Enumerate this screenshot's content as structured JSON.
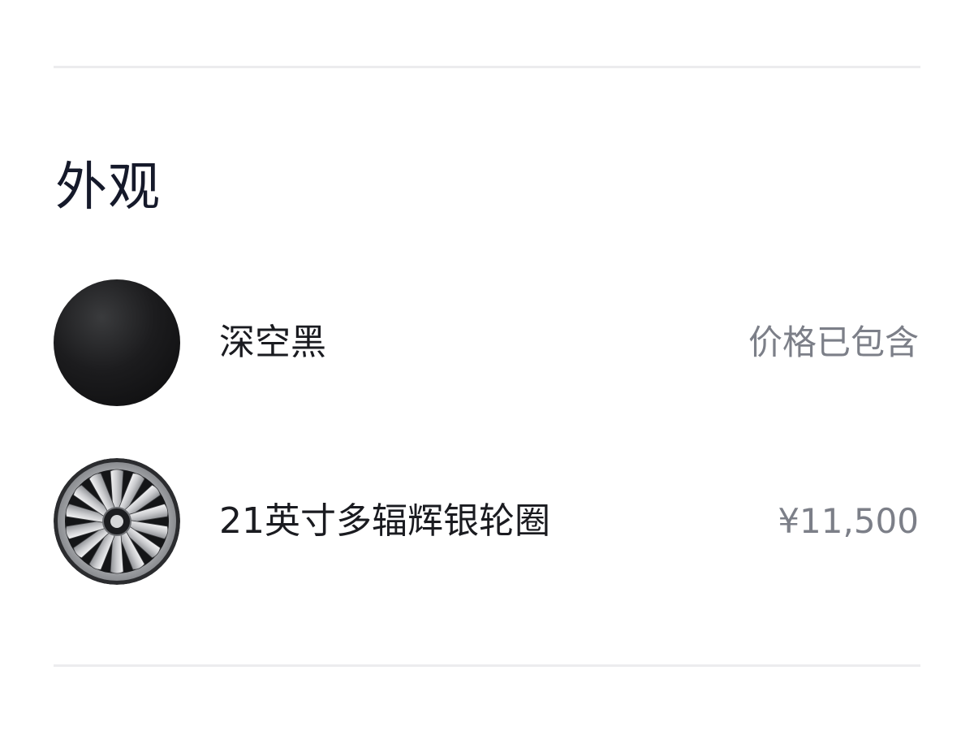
{
  "section": {
    "title": "外观"
  },
  "options": [
    {
      "name": "深空黑",
      "price": "价格已包含",
      "swatch": "paint-color-swatch",
      "color": "#141416"
    },
    {
      "name": "21英寸多辐辉银轮圈",
      "price": "¥11,500",
      "swatch": "wheel-rim-image"
    }
  ],
  "colors": {
    "title": "#15192a",
    "name": "#1a1b20",
    "price": "#7c7f88",
    "divider": "#ececee"
  }
}
